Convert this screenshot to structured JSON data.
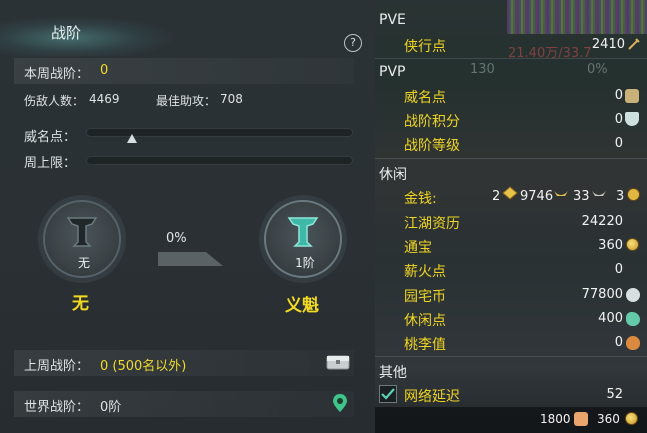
{
  "left_panel": {
    "title": "战阶",
    "help_label": "?",
    "current_rank_label": "本周战阶：",
    "current_rank_value": "0",
    "kills_label": "伤敌人数：",
    "kills_value": "4469",
    "assists_label": "最佳助攻：",
    "assists_value": "708",
    "prestige_label": "威名点：",
    "weekly_limit_label": "周上限：",
    "progress_pct": "0%",
    "current_rank": {
      "caption": "无",
      "name": "无"
    },
    "next_rank": {
      "caption": "1阶",
      "name": "义魁"
    },
    "last_week_label": "上周战阶：",
    "last_week_value": "0 (500名以外)",
    "world_rank_label": "世界战阶：",
    "world_rank_value": "0阶"
  },
  "right_panel": {
    "pve_header": "PVE",
    "xiaxing_label": "侠行点",
    "xiaxing_value": "2410",
    "pvp_header": "PVP",
    "weiming_label": "威名点",
    "weiming_value": "0",
    "zhanjie_points_label": "战阶积分",
    "zhanjie_points_value": "0",
    "zhanjie_level_label": "战阶等级",
    "zhanjie_level_value": "0",
    "leisure_header": "休闲",
    "money_label": "金钱:",
    "money_a": "2",
    "money_b": "9746",
    "money_c": "33",
    "money_d": "3",
    "jianghu_label": "江湖资历",
    "jianghu_value": "24220",
    "tongbao_label": "通宝",
    "tongbao_value": "360",
    "xinhuo_label": "薪火点",
    "xinhuo_value": "0",
    "yuanzhai_label": "园宅币",
    "yuanzhai_value": "77800",
    "xiuxian_label": "休闲点",
    "xiuxian_value": "400",
    "taoli_label": "桃李值",
    "taoli_value": "0",
    "other_header": "其他",
    "latency_label": "网络延迟",
    "latency_value": "52",
    "latency_checked": true,
    "footer_left_value": "1800",
    "footer_right_value": "360",
    "background_text_1": "21.40万/33.7",
    "background_text_2": "130",
    "background_text_3": "0%"
  },
  "colors": {
    "highlight_yellow": "#f1dc2a",
    "panel_bg": "#2a3034",
    "teal_accent": "#3fb8a8"
  }
}
